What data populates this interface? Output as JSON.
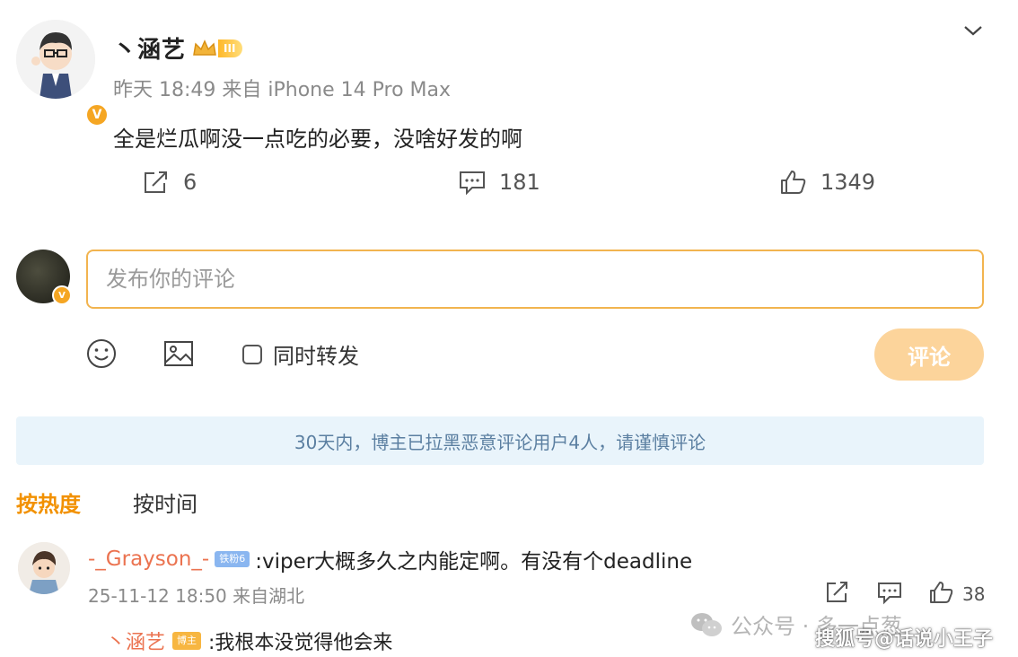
{
  "post": {
    "author_name": "丶涵艺",
    "level_badge": "III",
    "meta": "昨天 18:49 来自 iPhone 14 Pro Max",
    "text": "全是烂瓜啊没一点吃的必要，没啥好发的啊",
    "repost_count": "6",
    "comment_count": "181",
    "like_count": "1349"
  },
  "composer": {
    "placeholder": "发布你的评论",
    "repost_label": "同时转发",
    "submit_label": "评论"
  },
  "notice": "30天内，博主已拉黑恶意评论用户4人，请谨慎评论",
  "sort_tabs": {
    "hot": "按热度",
    "time": "按时间"
  },
  "comment": {
    "user": "-_Grayson_-",
    "tag": "铁粉6",
    "text": ":viper大概多久之内能定啊。有没有个deadline",
    "meta": "25-11-12 18:50 来自湖北",
    "like_count": "38",
    "reply": {
      "user": "丶涵艺",
      "tag": "博主",
      "text": ":我根本没觉得他会来"
    }
  },
  "watermarks": {
    "wechat": "公众号 · 多一点葱",
    "sohu": "搜狐号@话说小王子"
  },
  "colors": {
    "accent_orange": "#f29100",
    "username_orange": "#eb7350",
    "button_light": "#fcd49b",
    "notice_bg": "#e9f4fb"
  }
}
